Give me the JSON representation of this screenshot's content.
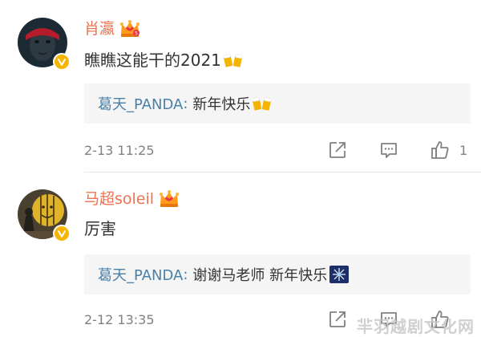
{
  "comments": [
    {
      "username": "肖瀛",
      "avatar": "avatar-portrait-red",
      "badge": "vip-crown-icon",
      "text": "瞧瞧这能干的2021",
      "text_emoji": "beer-cheers-icon",
      "reply": {
        "author": "葛天_PANDA",
        "colon": ":",
        "text": "新年快乐",
        "emoji": "beer-cheers-icon"
      },
      "timestamp": "2-13 11:25",
      "like_count": "1"
    },
    {
      "username": "马超soleil",
      "avatar": "avatar-portrait-yellow",
      "badge": "vip-crown-icon",
      "text": "厉害",
      "reply": {
        "author": "葛天_PANDA",
        "colon": ":",
        "text": "谢谢马老师 新年快乐",
        "emoji": "fireworks-icon"
      },
      "timestamp": "2-12 13:35",
      "like_count": ""
    }
  ],
  "watermark": "羋羽越剧文化网",
  "colors": {
    "username": "#eb7350",
    "reply_author": "#4a7fa6",
    "meta": "#808080",
    "reply_bg": "#f5f5f5",
    "verified": "#f7b500"
  }
}
